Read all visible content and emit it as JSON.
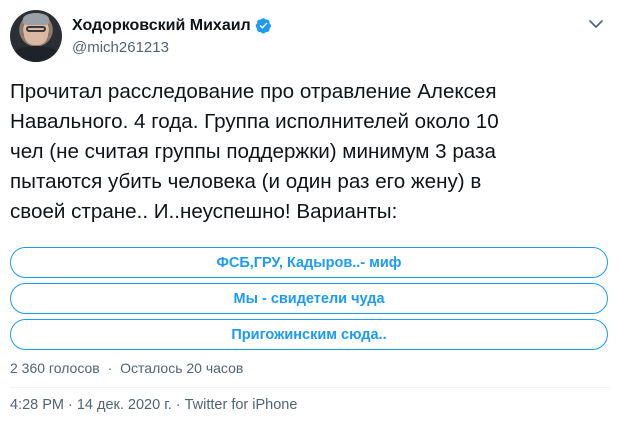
{
  "author": {
    "display_name": "Ходорковский Михаил",
    "handle": "@mich261213",
    "verified": true
  },
  "tweet": {
    "text": "Прочитал расследование про отравление Алексея\nНавального. 4 года. Группа исполнителей около 10\nчел (не считая группы поддержки) минимум 3 раза\nпытаются убить человека (и один раз его жену) в\nсвоей стране.. И..неуспешно! Варианты:"
  },
  "poll": {
    "choices": [
      "ФСБ,ГРУ, Кадыров..- миф",
      "Мы - свидетели чуда",
      "Пригожинским сюда.."
    ],
    "votes": "2 360 голосов",
    "separator": "·",
    "time_left": "Осталось 20 часов"
  },
  "footer": {
    "time": "4:28 PM",
    "date": "14 дек. 2020 г.",
    "source": "Twitter for iPhone",
    "separator": "·"
  },
  "colors": {
    "accent": "#1d9bf0",
    "secondary_text": "#536471",
    "primary_text": "#0f1419"
  },
  "icons": {
    "verified": "verified-badge-icon",
    "more": "chevron-down-icon"
  }
}
